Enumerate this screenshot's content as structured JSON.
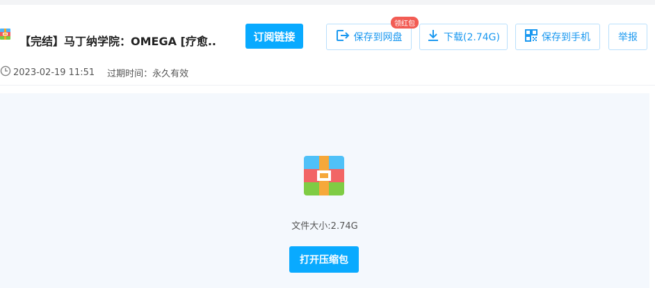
{
  "file": {
    "title": "【完结】马丁纳学院：OMEGA [疗愈...",
    "date": "2023-02-19 11:51",
    "expire_label": "过期时间：",
    "expire_value": "永久有效",
    "size_label": "文件大小:",
    "size_value": "2.74G"
  },
  "toolbar": {
    "subscribe_label": "订阅链接",
    "save_disk_label": "保存到网盘",
    "red_packet_badge": "领红包",
    "download_label": "下载(2.74G)",
    "save_phone_label": "保存到手机",
    "report_label": "举报"
  },
  "preview": {
    "open_label": "打开压缩包"
  },
  "icons": {
    "file_type": "archive-icon",
    "clock": "clock-icon",
    "save_disk": "export-icon",
    "download": "download-icon",
    "save_phone": "qrcode-icon"
  },
  "colors": {
    "primary": "#09aaff",
    "outline_text": "#1a98f0",
    "outline_border": "#b8dffc",
    "badge": "#f25c54",
    "preview_bg": "#f4f8fd"
  }
}
